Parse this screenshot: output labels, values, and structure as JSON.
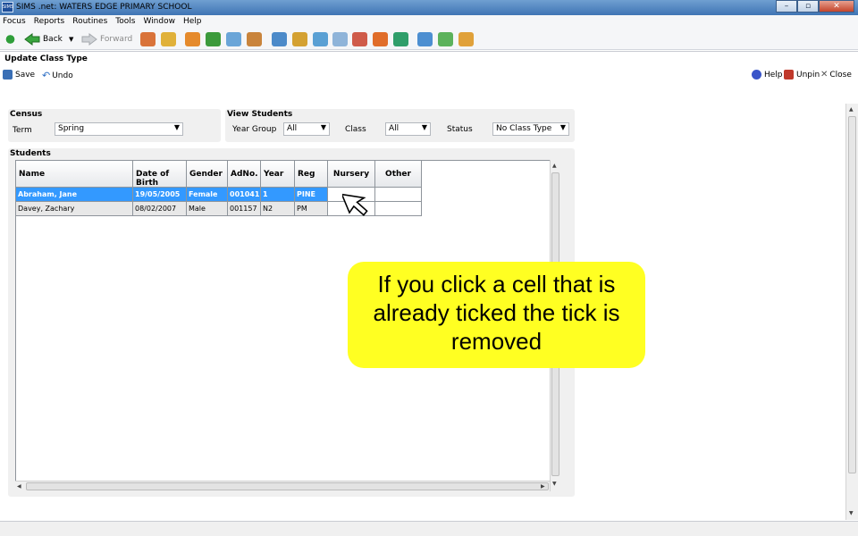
{
  "window": {
    "title": "SIMS .net: WATERS EDGE PRIMARY SCHOOL",
    "app_icon_text": "SIMS"
  },
  "menu": [
    {
      "label": "Focus"
    },
    {
      "label": "Reports"
    },
    {
      "label": "Routines"
    },
    {
      "label": "Tools"
    },
    {
      "label": "Window"
    },
    {
      "label": "Help"
    }
  ],
  "toolbar": {
    "back_label": "Back",
    "forward_label": "Forward"
  },
  "page": {
    "title": "Update Class Type",
    "save_label": "Save",
    "undo_label": "Undo",
    "help_label": "Help",
    "unpin_label": "Unpin",
    "close_label": "Close"
  },
  "census": {
    "title": "Census",
    "term_label": "Term",
    "term_value": "Spring"
  },
  "view_students": {
    "title": "View Students",
    "year_group_label": "Year Group",
    "year_group_value": "All",
    "class_label": "Class",
    "class_value": "All",
    "status_label": "Status",
    "status_value": "No Class Type"
  },
  "students": {
    "title": "Students",
    "columns": [
      "Name",
      "Date of Birth",
      "Gender",
      "AdNo.",
      "Year",
      "Reg",
      "Nursery",
      "Other"
    ],
    "rows": [
      {
        "name": "Abraham, Jane",
        "dob": "19/05/2005",
        "gender": "Female",
        "adno": "001041",
        "year": "1",
        "reg": "PINE",
        "nursery": "",
        "other": "",
        "selected": true
      },
      {
        "name": "Davey, Zachary",
        "dob": "08/02/2007",
        "gender": "Male",
        "adno": "001157",
        "year": "N2",
        "reg": "PM",
        "nursery": "",
        "other": "",
        "selected": false
      }
    ]
  },
  "callout": {
    "text": "If you click a cell that is already ticked the tick is removed",
    "color": "#ffff22"
  },
  "colors": {
    "selection": "#3399ff",
    "titlebar": "#3f74b4"
  }
}
